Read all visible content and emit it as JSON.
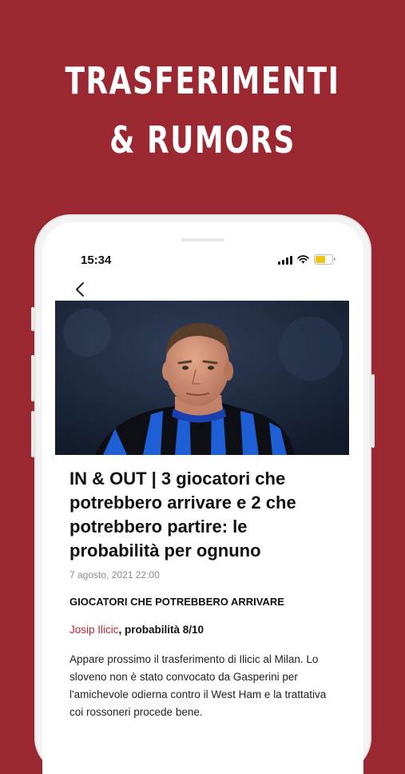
{
  "promo": {
    "line1": "TRASFERIMENTI",
    "line2": "& RUMORS"
  },
  "status_bar": {
    "time": "15:34",
    "battery_level": 0.6,
    "battery_color": "#f0c419"
  },
  "nav": {
    "back_icon": "chevron-left-icon"
  },
  "article": {
    "title": "IN & OUT | 3 giocatori che potrebbero arrivare e 2 che potrebbero partire: le probabilità per ognuno",
    "date": "7 agosto, 2021 22:00",
    "section_heading": "GIOCATORI CHE POTREBBERO ARRIVARE",
    "player_link": "Josip Ilicic",
    "player_probability": ", probabilità 8/10",
    "body": "Appare prossimo il trasferimento di Ilicic al Milan. Lo sloveno non è stato convocato da Gasperini per l'amichevole odierna contro il West Ham e la trattativa coi rossoneri procede bene."
  },
  "colors": {
    "background": "#9b2830",
    "link": "#c0272d"
  }
}
